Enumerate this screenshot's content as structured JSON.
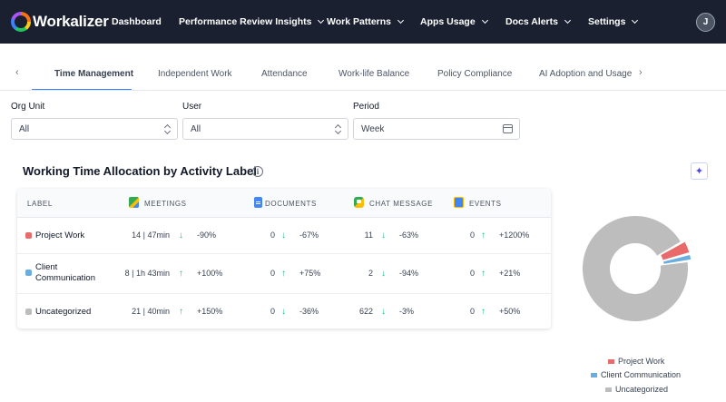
{
  "app": {
    "name": "Workalizer",
    "avatar_initial": "J"
  },
  "nav": {
    "dashboard": "Dashboard",
    "performance": "Performance Review Insights",
    "work_patterns": "Work Patterns",
    "apps_usage": "Apps Usage",
    "docs_alerts": "Docs Alerts",
    "settings": "Settings"
  },
  "tabs": {
    "prev": "‹",
    "next": "›",
    "items": [
      "Time Management",
      "Independent Work",
      "Attendance",
      "Work-life Balance",
      "Policy Compliance",
      "AI Adoption and Usage"
    ],
    "active_index": 0
  },
  "filters": {
    "org_unit": {
      "label": "Org Unit",
      "value": "All"
    },
    "user": {
      "label": "User",
      "value": "All"
    },
    "period": {
      "label": "Period",
      "value": "Week"
    }
  },
  "section": {
    "title": "Working Time Allocation by Activity Label",
    "info_glyph": "i",
    "ai_glyph": "✦"
  },
  "table": {
    "headers": {
      "label": "LABEL",
      "meetings": "MEETINGS",
      "documents": "DOCUMENTS",
      "chat": "CHAT MESSAGE",
      "events": "EVENTS"
    },
    "rows": [
      {
        "label": "Project Work",
        "color": "#e86a6a",
        "meetings": "14 | 47min",
        "meetings_dir": "↓",
        "meetings_pct": "-90%",
        "documents": "0",
        "documents_dir": "↓",
        "documents_pct": "-67%",
        "chat": "11",
        "chat_dir": "↓",
        "chat_pct": "-63%",
        "events": "0",
        "events_dir": "↑",
        "events_pct": "+1200%"
      },
      {
        "label": "Client Communication",
        "color": "#6aaee0",
        "meetings": "8 | 1h 43min",
        "meetings_dir": "↑",
        "meetings_pct": "+100%",
        "documents": "0",
        "documents_dir": "↑",
        "documents_pct": "+75%",
        "chat": "2",
        "chat_dir": "↓",
        "chat_pct": "-94%",
        "events": "0",
        "events_dir": "↑",
        "events_pct": "+21%"
      },
      {
        "label": "Uncategorized",
        "color": "#bdbdbd",
        "meetings": "21 | 40min",
        "meetings_dir": "↑",
        "meetings_pct": "+150%",
        "documents": "0",
        "documents_dir": "↓",
        "documents_pct": "-36%",
        "chat": "622",
        "chat_dir": "↓",
        "chat_pct": "-3%",
        "events": "0",
        "events_dir": "↑",
        "events_pct": "+50%"
      }
    ]
  },
  "chart_data": {
    "type": "pie",
    "categories": [
      "Project Work",
      "Client Communication",
      "Uncategorized"
    ],
    "values": [
      4,
      2,
      94
    ],
    "colors": [
      "#e86a6a",
      "#6aaee0",
      "#bdbdbd"
    ],
    "donut": true,
    "legend_position": "bottom"
  }
}
